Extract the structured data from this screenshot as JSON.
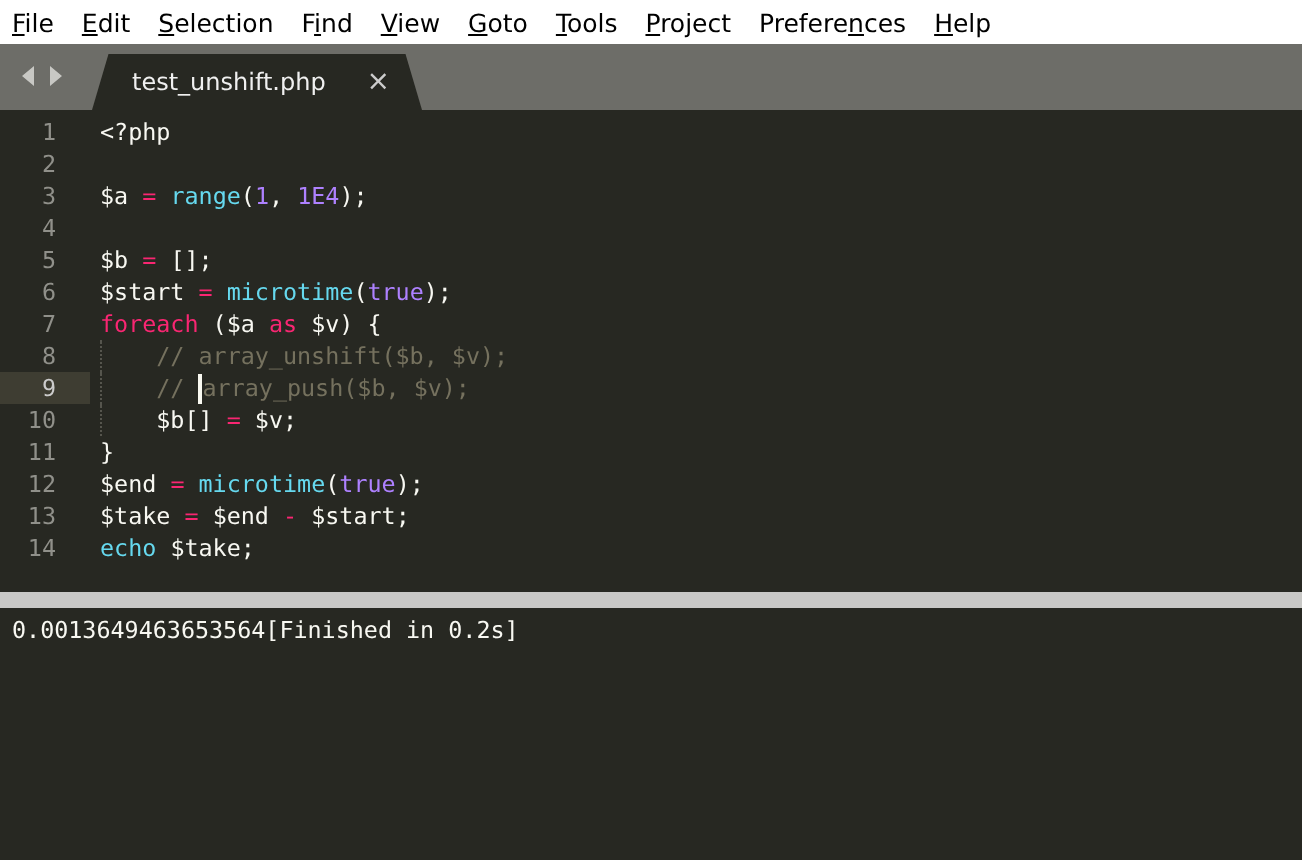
{
  "menu": [
    {
      "key": "F",
      "post": "ile"
    },
    {
      "key": "E",
      "post": "dit"
    },
    {
      "key": "S",
      "post": "election"
    },
    {
      "pre": "F",
      "key": "i",
      "post": "nd"
    },
    {
      "key": "V",
      "post": "iew"
    },
    {
      "key": "G",
      "post": "oto"
    },
    {
      "key": "T",
      "post": "ools"
    },
    {
      "key": "P",
      "post": "roject"
    },
    {
      "pre": "Prefere",
      "key": "n",
      "post": "ces"
    },
    {
      "key": "H",
      "post": "elp"
    }
  ],
  "tabs": [
    {
      "label": "test_unshift.php",
      "close": "×",
      "selected": true
    }
  ],
  "editor": {
    "lines": [
      {
        "number": "1",
        "current": false,
        "tokens": [
          {
            "kind": "plain",
            "text": "<?php"
          }
        ]
      },
      {
        "number": "2",
        "current": false
      },
      {
        "number": "3",
        "current": false,
        "tokens": [
          {
            "kind": "var",
            "text": "$a "
          },
          {
            "kind": "op",
            "text": "="
          },
          {
            "kind": "func",
            "text": " range"
          },
          {
            "kind": "plain",
            "text": "("
          },
          {
            "kind": "num",
            "text": "1"
          },
          {
            "kind": "plain",
            "text": ", "
          },
          {
            "kind": "num",
            "text": "1E4"
          },
          {
            "kind": "plain",
            "text": ");"
          }
        ]
      },
      {
        "number": "4",
        "current": false
      },
      {
        "number": "5",
        "current": false,
        "tokens": [
          {
            "kind": "var",
            "text": "$b "
          },
          {
            "kind": "op",
            "text": "="
          },
          {
            "kind": "plain",
            "text": " [];"
          }
        ]
      },
      {
        "number": "6",
        "current": false,
        "tokens": [
          {
            "kind": "var",
            "text": "$start "
          },
          {
            "kind": "op",
            "text": "="
          },
          {
            "kind": "func",
            "text": " microtime"
          },
          {
            "kind": "plain",
            "text": "("
          },
          {
            "kind": "num",
            "text": "true"
          },
          {
            "kind": "plain",
            "text": ");"
          }
        ]
      },
      {
        "number": "7",
        "current": false,
        "tokens": [
          {
            "kind": "kw",
            "text": "foreach"
          },
          {
            "kind": "plain",
            "text": " ($a "
          },
          {
            "kind": "kw",
            "text": "as"
          },
          {
            "kind": "plain",
            "text": " $v) {"
          }
        ]
      },
      {
        "number": "8",
        "current": false,
        "tokens": [
          {
            "kind": "indent"
          },
          {
            "kind": "comment",
            "text": "// array_unshift($b, $v);"
          }
        ]
      },
      {
        "number": "9",
        "current": true,
        "tokens": [
          {
            "kind": "indent"
          },
          {
            "kind": "comment",
            "text": "// "
          },
          {
            "kind": "caret"
          },
          {
            "kind": "comment",
            "text": "array_push($b, $v);"
          }
        ]
      },
      {
        "number": "10",
        "current": false,
        "tokens": [
          {
            "kind": "indent"
          },
          {
            "kind": "var",
            "text": "$b[] "
          },
          {
            "kind": "op",
            "text": "="
          },
          {
            "kind": "plain",
            "text": " $v;"
          }
        ]
      },
      {
        "number": "11",
        "current": false,
        "tokens": [
          {
            "kind": "plain",
            "text": "}"
          }
        ]
      },
      {
        "number": "12",
        "current": false,
        "tokens": [
          {
            "kind": "var",
            "text": "$end "
          },
          {
            "kind": "op",
            "text": "="
          },
          {
            "kind": "func",
            "text": " microtime"
          },
          {
            "kind": "plain",
            "text": "("
          },
          {
            "kind": "num",
            "text": "true"
          },
          {
            "kind": "plain",
            "text": ");"
          }
        ]
      },
      {
        "number": "13",
        "current": false,
        "tokens": [
          {
            "kind": "var",
            "text": "$take "
          },
          {
            "kind": "op",
            "text": "="
          },
          {
            "kind": "plain",
            "text": " $end "
          },
          {
            "kind": "op",
            "text": "-"
          },
          {
            "kind": "plain",
            "text": " $start;"
          }
        ]
      },
      {
        "number": "14",
        "current": false,
        "tokens": [
          {
            "kind": "func",
            "text": "echo"
          },
          {
            "kind": "plain",
            "text": " $take;"
          }
        ]
      }
    ]
  },
  "output": {
    "text": "0.0013649463653564[Finished in 0.2s]"
  }
}
